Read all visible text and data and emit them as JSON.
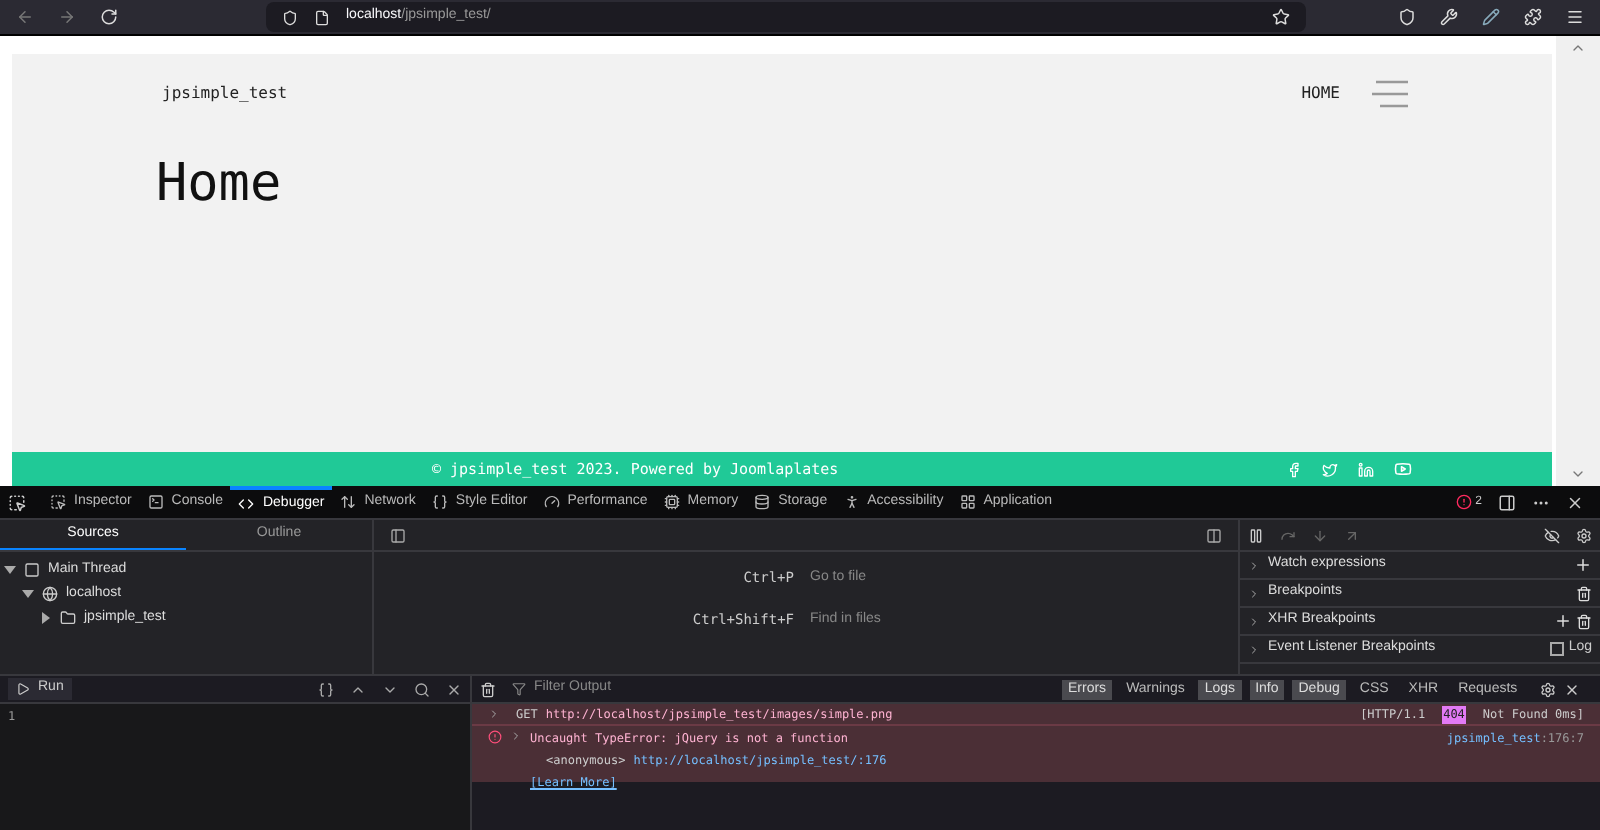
{
  "browser": {
    "url_host": "localhost",
    "url_path": "/jpsimple_test/"
  },
  "page": {
    "site_name": "jpsimple_test",
    "nav": [
      {
        "label": "HOME",
        "selected": true
      }
    ],
    "heading": "Home",
    "footer_text": "© jpsimple_test 2023. Powered by Joomlaplates"
  },
  "devtools": {
    "tabs": [
      {
        "label": "Inspector",
        "selected": false
      },
      {
        "label": "Console",
        "selected": false
      },
      {
        "label": "Debugger",
        "selected": true
      },
      {
        "label": "Network",
        "selected": false
      },
      {
        "label": "Style Editor",
        "selected": false
      },
      {
        "label": "Performance",
        "selected": false
      },
      {
        "label": "Memory",
        "selected": false
      },
      {
        "label": "Storage",
        "selected": false
      },
      {
        "label": "Accessibility",
        "selected": false
      },
      {
        "label": "Application",
        "selected": false
      }
    ],
    "error_count": "2",
    "source_tabs": [
      {
        "label": "Sources",
        "selected": true
      },
      {
        "label": "Outline",
        "selected": false
      }
    ],
    "tree": [
      {
        "label": "Main Thread",
        "expanded": true,
        "children": [
          {
            "label": "localhost",
            "expanded": true,
            "children": [
              {
                "label": "jpsimple_test",
                "expanded": false
              }
            ]
          }
        ]
      }
    ],
    "shortcuts": [
      {
        "keys": "Ctrl+P",
        "label": "Go to file"
      },
      {
        "keys": "Ctrl+Shift+F",
        "label": "Find in files"
      }
    ],
    "sections": [
      {
        "label": "Watch expressions",
        "kind": "add"
      },
      {
        "label": "Breakpoints",
        "kind": "delete"
      },
      {
        "label": "XHR Breakpoints",
        "kind": "add_delete"
      },
      {
        "label": "Event Listener Breakpoints",
        "kind": "log",
        "log_label": "Log",
        "checked": false
      }
    ],
    "editor": {
      "run_label": "Run",
      "line_numbers": [
        "1"
      ]
    },
    "console": {
      "filter_placeholder": "Filter Output",
      "filters": [
        {
          "label": "Errors",
          "selected": true
        },
        {
          "label": "Warnings",
          "selected": false
        },
        {
          "label": "Logs",
          "selected": true
        },
        {
          "label": "Info",
          "selected": true
        },
        {
          "label": "Debug",
          "selected": true
        },
        {
          "label": "CSS",
          "selected": false
        },
        {
          "label": "XHR",
          "selected": false
        },
        {
          "label": "Requests",
          "selected": false
        }
      ],
      "messages": [
        {
          "kind": "network",
          "method": "GET",
          "url": "http://localhost/jpsimple_test/images/simple.png",
          "protocol": "[HTTP/1.1",
          "status": "404",
          "status_text": "Not Found 0ms]"
        },
        {
          "kind": "error",
          "text": "Uncaught TypeError: jQuery is not a function",
          "frame": "<anonymous>",
          "frame_url": "http://localhost/jpsimple_test/:176",
          "learn_more": "[Learn More]",
          "source_file": "jpsimple_test",
          "source_pos": ":176:7"
        }
      ]
    }
  }
}
